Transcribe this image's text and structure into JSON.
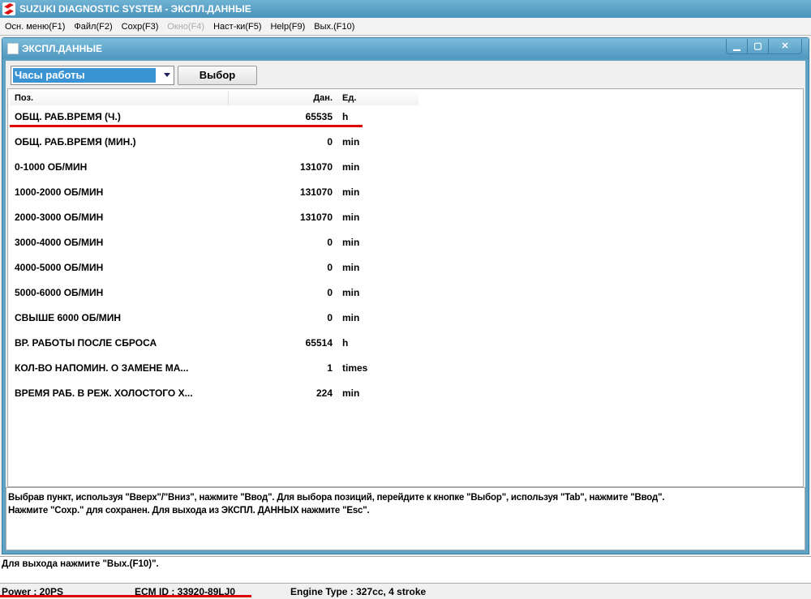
{
  "app": {
    "title": "SUZUKI DIAGNOSTIC SYSTEM - ЭКСПЛ.ДАННЫЕ"
  },
  "menu": [
    {
      "label": "Осн. меню(F1)",
      "enabled": true
    },
    {
      "label": "Файл(F2)",
      "enabled": true
    },
    {
      "label": "Сохр(F3)",
      "enabled": true
    },
    {
      "label": "Окно(F4)",
      "enabled": false
    },
    {
      "label": "Наст-ки(F5)",
      "enabled": true
    },
    {
      "label": "Help(F9)",
      "enabled": true
    },
    {
      "label": "Вых.(F10)",
      "enabled": true
    }
  ],
  "window": {
    "title": "ЭКСПЛ.ДАННЫЕ"
  },
  "selector": {
    "value": "Часы работы",
    "button": "Выбор"
  },
  "table": {
    "headers": [
      "Поз.",
      "Дан.",
      "Ед."
    ],
    "rows": [
      [
        "ОБЩ. РАБ.ВРЕМЯ (Ч.)",
        "65535",
        "h"
      ],
      [
        "ОБЩ. РАБ.ВРЕМЯ (МИН.)",
        "0",
        "min"
      ],
      [
        "0-1000 ОБ/МИН",
        "131070",
        "min"
      ],
      [
        "1000-2000 ОБ/МИН",
        "131070",
        "min"
      ],
      [
        "2000-3000 ОБ/МИН",
        "131070",
        "min"
      ],
      [
        "3000-4000 ОБ/МИН",
        "0",
        "min"
      ],
      [
        "4000-5000 ОБ/МИН",
        "0",
        "min"
      ],
      [
        "5000-6000 ОБ/МИН",
        "0",
        "min"
      ],
      [
        "СВЫШЕ 6000 ОБ/МИН",
        "0",
        "min"
      ],
      [
        "ВР. РАБОТЫ ПОСЛЕ СБРОСА",
        "65514",
        "h"
      ],
      [
        "КОЛ-ВО НАПОМИН. О ЗАМЕНЕ МА...",
        "1",
        "times"
      ],
      [
        "ВРЕМЯ РАБ. В РЕЖ. ХОЛОСТОГО Х...",
        "224",
        "min"
      ]
    ]
  },
  "help": {
    "line1": "Выбрав пункт, используя \"Вверх\"/\"Вниз\", нажмите \"Ввод\". Для выбора позиций, перейдите к кнопке \"Выбор\", используя \"Tab\", нажмите \"Ввод\".",
    "line2": "Нажмите \"Сохр.\" для сохранен. Для выхода из ЭКСПЛ. ДАННЫХ нажмите \"Esc\"."
  },
  "status": "Для выхода нажмите \"Вых.(F10)\".",
  "info": {
    "power": "Power :  20PS",
    "ecm": "ECM ID : 33920-89LJ0",
    "engine": "Engine Type :  327cc,  4 stroke"
  }
}
